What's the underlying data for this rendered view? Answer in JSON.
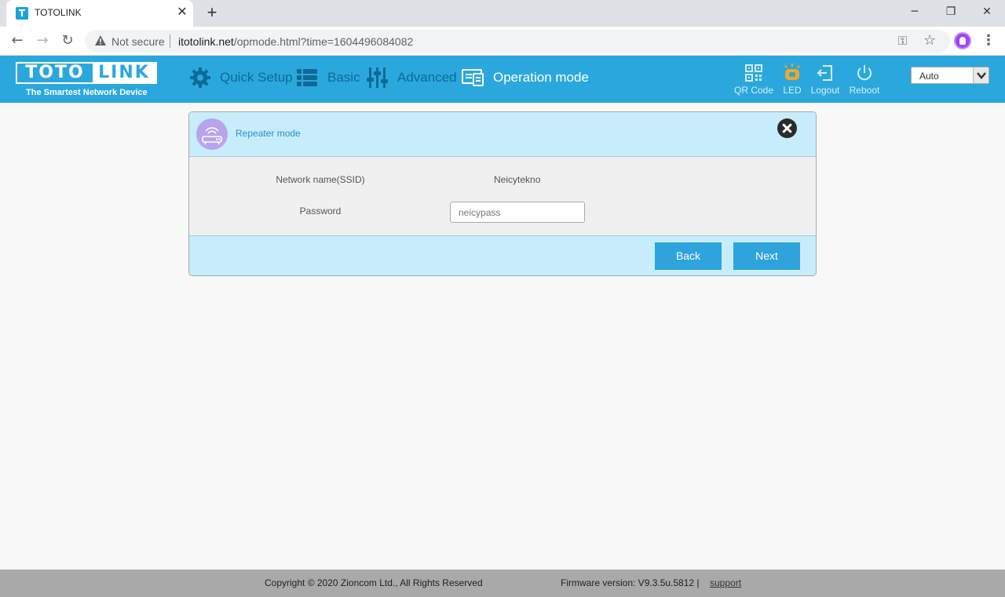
{
  "browser": {
    "tab_title": "TOTOLINK",
    "tab_favicon_letter": "T",
    "security_label": "Not secure",
    "url_host": "itotolink.net",
    "url_path": "/opmode.html?time=1604496084082"
  },
  "header": {
    "logo_left": "TOTO",
    "logo_right": "LINK",
    "tagline": "The Smartest Network Device",
    "nav": [
      {
        "label": "Quick Setup"
      },
      {
        "label": "Basic"
      },
      {
        "label": "Advanced"
      },
      {
        "label": "Operation mode"
      }
    ],
    "utilities": [
      {
        "label": "QR Code"
      },
      {
        "label": "LED"
      },
      {
        "label": "Logout"
      },
      {
        "label": "Reboot"
      }
    ],
    "language_selected": "Auto"
  },
  "dialog": {
    "title": "Repeater mode",
    "ssid_label": "Network name(SSID)",
    "ssid_value": "Neicytekno",
    "password_label": "Password",
    "password_value": "neicypass",
    "back_label": "Back",
    "next_label": "Next"
  },
  "footer": {
    "copyright": "Copyright © 2020 Zioncom Ltd., All Rights Reserved",
    "firmware": "Firmware version: V9.3.5u.5812 |",
    "support_label": "support"
  },
  "colors": {
    "header_bg": "#2aa8dd",
    "nav_inactive": "#0d6a98",
    "button_bg": "#2ea3dc",
    "dialog_band": "#c7ecfb",
    "led_icon": "#f5a623"
  }
}
